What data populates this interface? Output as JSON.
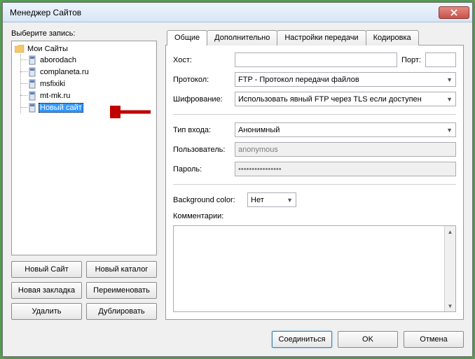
{
  "window": {
    "title": "Менеджер Сайтов"
  },
  "left": {
    "prompt": "Выберите запись:",
    "root": "Мои Сайты",
    "items": [
      {
        "label": "aborodach"
      },
      {
        "label": "complaneta.ru"
      },
      {
        "label": "msfixiki"
      },
      {
        "label": "mt-mk.ru"
      },
      {
        "label": "Новый сайт",
        "selected": true
      }
    ],
    "buttons": {
      "new_site": "Новый Сайт",
      "new_folder": "Новый каталог",
      "new_bookmark": "Новая закладка",
      "rename": "Переименовать",
      "delete": "Удалить",
      "duplicate": "Дублировать"
    }
  },
  "tabs": {
    "general": "Общие",
    "advanced": "Дополнительно",
    "transfer": "Настройки передачи",
    "charset": "Кодировка"
  },
  "form": {
    "host_label": "Хост:",
    "host_value": "",
    "port_label": "Порт:",
    "port_value": "",
    "protocol_label": "Протокол:",
    "protocol_value": "FTP - Протокол передачи файлов",
    "encryption_label": "Шифрование:",
    "encryption_value": "Использовать явный FTP через TLS если доступен",
    "logon_label": "Тип входа:",
    "logon_value": "Анонимный",
    "user_label": "Пользователь:",
    "user_value": "anonymous",
    "pass_label": "Пароль:",
    "pass_value": "••••••••••••••••",
    "bgcolor_label": "Background color:",
    "bgcolor_value": "Нет",
    "comments_label": "Комментарии:",
    "comments_value": ""
  },
  "footer": {
    "connect": "Соединиться",
    "ok": "OK",
    "cancel": "Отмена"
  }
}
